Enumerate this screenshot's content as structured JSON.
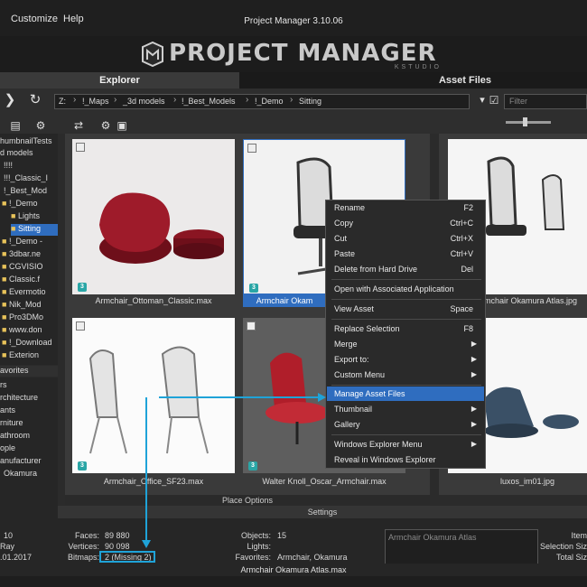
{
  "menu": {
    "customize": "Customize",
    "help": "Help",
    "title": "Project Manager 3.10.06"
  },
  "banner": {
    "logo_text": "PROJECT MANAGER",
    "logo_sub": "KSTUDIO"
  },
  "tabs": {
    "explorer": "Explorer",
    "asset_files": "Asset Files"
  },
  "path": {
    "crumbs": [
      "Z:",
      "!_Maps",
      "_3d models",
      "!_Best_Models",
      "!_Demo",
      "Sitting"
    ],
    "filter_placeholder": "Filter"
  },
  "tree": {
    "items": [
      "humbnailTests",
      "d models",
      "!!!!",
      "!!!_Classic_I",
      "!_Best_Mod",
      "!_Demo",
      "Lights",
      "Sitting",
      "!_Demo -",
      "3dbar.ne",
      "CGVISIO",
      "Classic.f",
      "Evermotio",
      "Nik_Mod",
      "Pro3DMo",
      "www.don",
      "!_Download",
      "Exterion"
    ]
  },
  "favorites": {
    "header": "avorites",
    "items": [
      "rs",
      "rchitecture",
      "ants",
      "rniture",
      "athroom",
      "ople",
      "anufacturer",
      "Okamura"
    ]
  },
  "thumbnails": [
    {
      "caption": "Armchair_Ottoman_Classic.max",
      "badge": "3"
    },
    {
      "caption": "Armchair Okam",
      "badge": "3"
    },
    {
      "caption": "mchair Okamura Atlas.jpg",
      "badge": ""
    },
    {
      "caption": "Armchair_Office_SF23.max",
      "badge": "3"
    },
    {
      "caption": "Walter Knoll_Oscar_Armchair.max",
      "badge": "3"
    },
    {
      "caption": "luxos_im01.jpg",
      "badge": ""
    }
  ],
  "context_menu": {
    "items": [
      {
        "label": "Rename",
        "shortcut": "F2"
      },
      {
        "label": "Copy",
        "shortcut": "Ctrl+C"
      },
      {
        "label": "Cut",
        "shortcut": "Ctrl+X"
      },
      {
        "label": "Paste",
        "shortcut": "Ctrl+V"
      },
      {
        "label": "Delete from Hard Drive",
        "shortcut": "Del"
      },
      {
        "label": "Open with Associated Application",
        "shortcut": ""
      },
      {
        "label": "View Asset",
        "shortcut": "Space"
      },
      {
        "label": "Replace Selection",
        "shortcut": "F8"
      },
      {
        "label": "Merge",
        "shortcut": ""
      },
      {
        "label": "Export to:",
        "shortcut": ""
      },
      {
        "label": "Custom Menu",
        "shortcut": ""
      },
      {
        "label": "Manage Asset Files",
        "shortcut": ""
      },
      {
        "label": "Thumbnail",
        "shortcut": ""
      },
      {
        "label": "Gallery",
        "shortcut": ""
      },
      {
        "label": "Windows Explorer Menu",
        "shortcut": ""
      },
      {
        "label": "Reveal in Windows Explorer",
        "shortcut": ""
      }
    ]
  },
  "bars": {
    "place_options": "Place Options",
    "settings": "Settings"
  },
  "status": {
    "left1": "10",
    "left2": "Ray",
    "left3": ".01.2017",
    "faces_label": "Faces:",
    "faces_value": "89 880",
    "vertices_label": "Vertices:",
    "vertices_value": "90 098",
    "bitmaps_label": "Bitmaps:",
    "bitmaps_value": "2 (Missing 2)",
    "objects_label": "Objects:",
    "objects_value": "15",
    "lights_label": "Lights:",
    "lights_value": "",
    "favorites_label": "Favorites:",
    "favorites_value": "Armchair, Okamura",
    "info_text": "Armchair Okamura Atlas",
    "right1": "Item",
    "right2": "Selection Siz",
    "right3": "Total Siz",
    "filename": "Armchair Okamura Atlas.max"
  },
  "colors": {
    "accent": "#2f6dbf",
    "annotation": "#1fa3d8",
    "badge": "#2aa6a6"
  }
}
